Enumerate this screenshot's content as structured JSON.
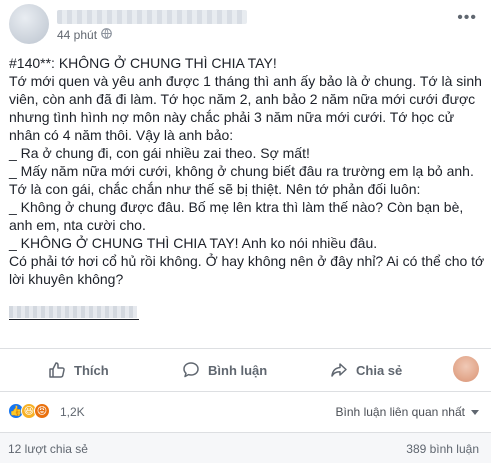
{
  "header": {
    "time": "44 phút",
    "options_icon": "more-options-icon"
  },
  "post": {
    "lines": [
      "#140**: KHÔNG Ở CHUNG THÌ CHIA TAY!",
      "Tớ mới quen và yêu anh được 1 tháng thì anh ấy bảo là ở chung. Tớ là sinh",
      "viên, còn anh đã đi làm. Tớ học năm 2, anh bảo 2 năm nữa mới cưới được",
      "nhưng tình hình nợ môn này chắc phải 3 năm nữa mới cưới. Tớ học cử",
      "nhân có 4 năm thôi. Vậy là anh bảo:",
      "_ Ra ở chung đi, con gái nhiều zai theo. Sợ mất!",
      "_ Mấy năm nữa mới cưới, không ở chung biết đâu ra trường em lạ bỏ anh.",
      "Tớ là con gái, chắc chắn như thế sẽ bị thiệt. Nên tớ phản đối luôn:",
      "_ Không ở chung được đâu. Bố mẹ lên ktra thì làm thế nào? Còn bạn bè,",
      "anh em, nta cười cho.",
      "_ KHÔNG Ở CHUNG THÌ CHIA TAY! Anh ko nói nhiều đâu.",
      "Có phải tớ hơi cổ hủ rồi không. Ở hay không nên ở đây nhỉ? Ai có thể cho tớ",
      "lời khuyên không?"
    ]
  },
  "actions": {
    "like": "Thích",
    "comment": "Bình luận",
    "share": "Chia sẻ"
  },
  "reactions": {
    "count": "1,2K",
    "sort_label": "Bình luận liên quan nhất"
  },
  "footer": {
    "shares": "12 lượt chia sẻ",
    "comments": "389 bình luận"
  },
  "colors": {
    "text": "#1d2129",
    "muted": "#606770",
    "like_blue": "#1877f2",
    "border": "#dddfe2"
  }
}
